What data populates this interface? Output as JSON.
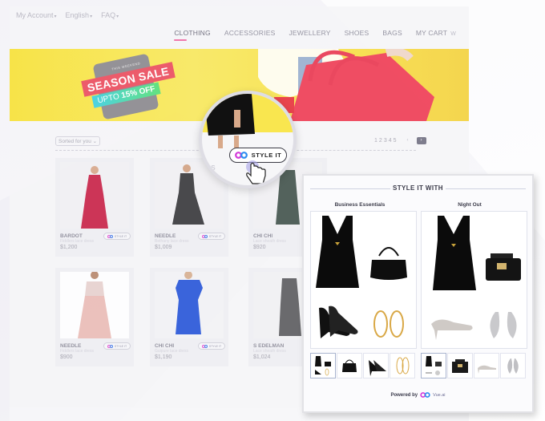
{
  "topbar": {
    "my_account": "My Account",
    "language": "English",
    "faq": "FAQ"
  },
  "nav": {
    "items": [
      "CLOTHING",
      "ACCESSORIES",
      "JEWELLERY",
      "SHOES",
      "BAGS",
      "MY CART"
    ],
    "active": "CLOTHING",
    "accent_color": "#ef6ea6"
  },
  "banner": {
    "top_text": "THIS WEEKEND",
    "title": "SEASON SALE",
    "offer_prefix": "UPTO",
    "offer_value": "15% OFF"
  },
  "listing": {
    "sort_label": "Sorted for you",
    "pages": [
      "1",
      "2",
      "3",
      "4",
      "5"
    ],
    "prev_label": "‹",
    "next_label": "›"
  },
  "products": [
    {
      "name": "BARDOT",
      "subtitle": "Fiddlers lace dress",
      "price": "$1,200",
      "button": "STYLE IT"
    },
    {
      "name": "NEEDLE",
      "subtitle": "Bethany lace dress",
      "price": "$1,009",
      "button": "STYLE IT"
    },
    {
      "name": "CHI CHI",
      "subtitle": "Lace sheath dress",
      "price": "$920",
      "button": "STYLE IT"
    },
    {
      "name": "NEEDLE",
      "subtitle": "Fiddlers lace dress",
      "price": "$900",
      "button": "STYLE IT"
    },
    {
      "name": "CHI CHI",
      "subtitle": "Guipure lace dress",
      "price": "$1,190",
      "button": "STYLE IT"
    },
    {
      "name": "S EDELMAN",
      "subtitle": "Lace sheath dress",
      "price": "$1,024",
      "button": "STYLE IT"
    }
  ],
  "magnifier": {
    "button_label": "STYLE IT",
    "partial_text": "ress"
  },
  "style_panel": {
    "title": "STYLE IT WITH",
    "looks": [
      {
        "name": "Business Essentials",
        "items": [
          "black-dress",
          "black-handbag",
          "black-pumps",
          "gold-hoop-earrings"
        ]
      },
      {
        "name": "Night Out",
        "items": [
          "black-dress",
          "studded-crossbody-bag",
          "glitter-heels",
          "crystal-wing-earrings"
        ]
      }
    ],
    "powered_by": "Powered by",
    "brand": "Vue.ai"
  }
}
